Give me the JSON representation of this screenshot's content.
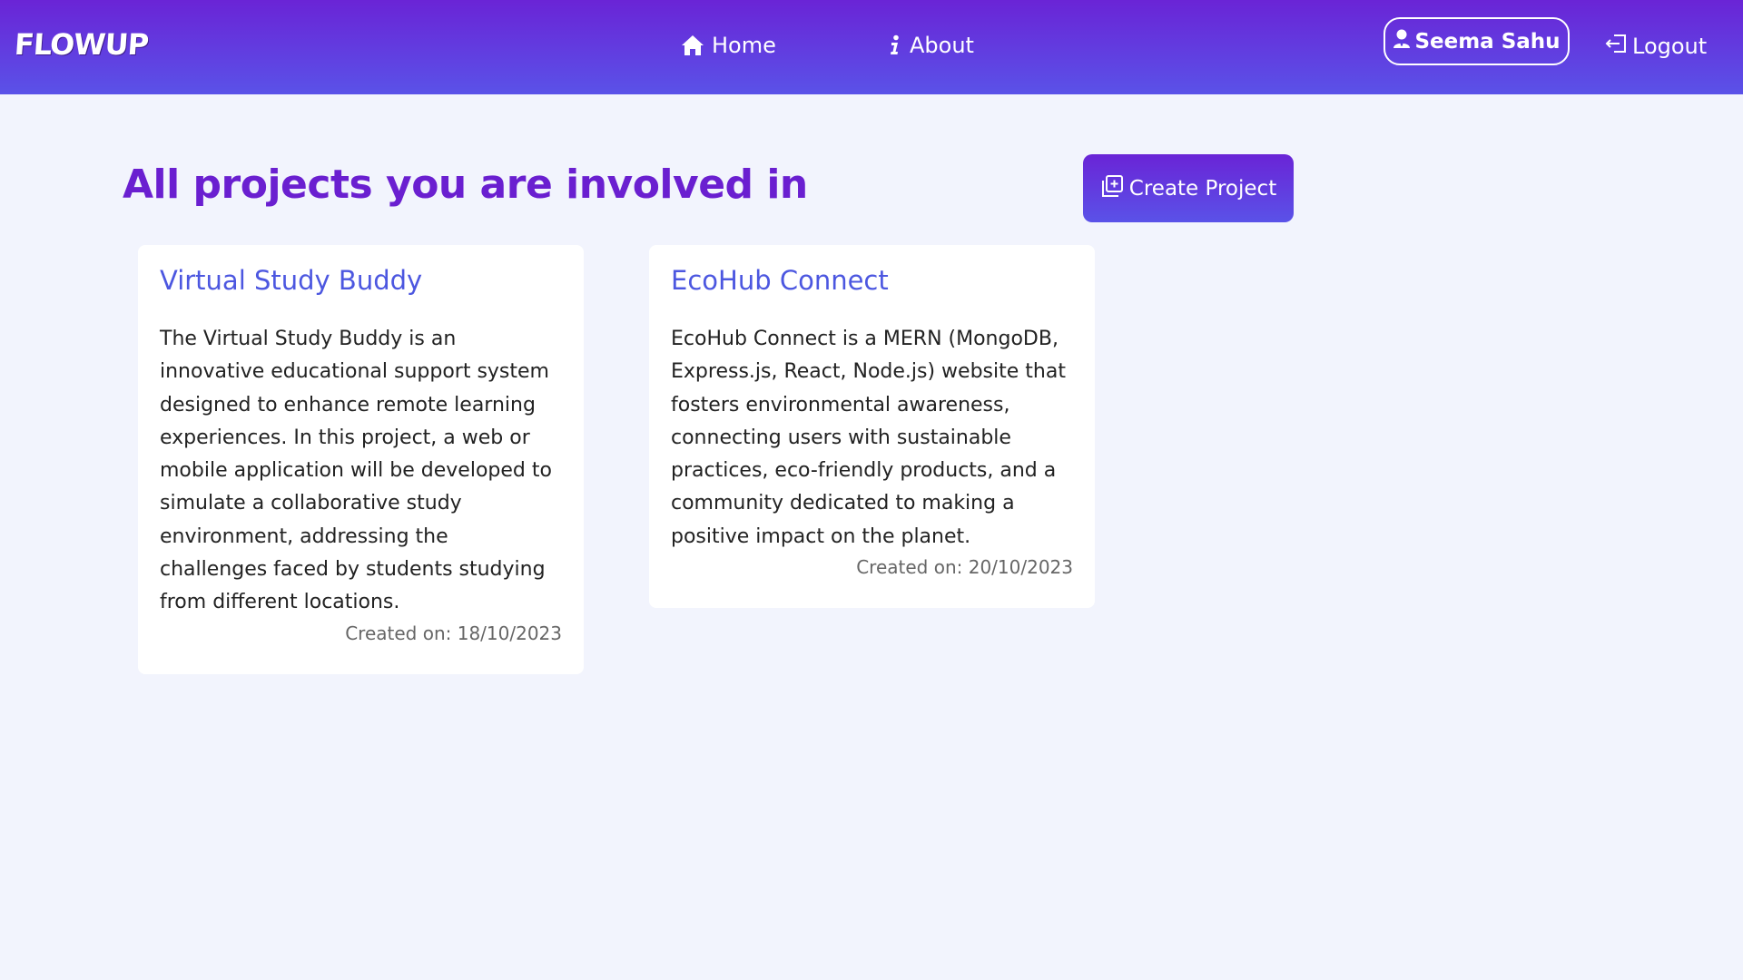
{
  "navbar": {
    "brand": "FLOWUP",
    "home_label": "Home",
    "about_label": "About",
    "user_name": "Seema Sahu",
    "logout_label": "Logout",
    "icons": {
      "home": "home-icon",
      "about": "info-icon",
      "user": "user-icon",
      "logout": "logout-icon"
    },
    "gradient": [
      "#6a24d6",
      "#5a52e8"
    ]
  },
  "main": {
    "title": "All projects you are involved in",
    "create_button_label": "Create Project",
    "create_icon": "add-copy-icon",
    "title_color": "#6a1fd0",
    "projects": [
      {
        "title": "Virtual Study Buddy",
        "description": "The Virtual Study Buddy is an innovative educational support system designed to enhance remote learning experiences. In this project, a web or mobile application will be developed to simulate a collaborative study environment, addressing the challenges faced by students studying from different locations.",
        "created": "Created on: 18/10/2023"
      },
      {
        "title": "EcoHub Connect",
        "description": "EcoHub Connect is a MERN (MongoDB, Express.js, React, Node.js) website that fosters environmental awareness, connecting users with sustainable practices, eco-friendly products, and a community dedicated to making a positive impact on the planet.",
        "created": "Created on: 20/10/2023"
      }
    ]
  }
}
